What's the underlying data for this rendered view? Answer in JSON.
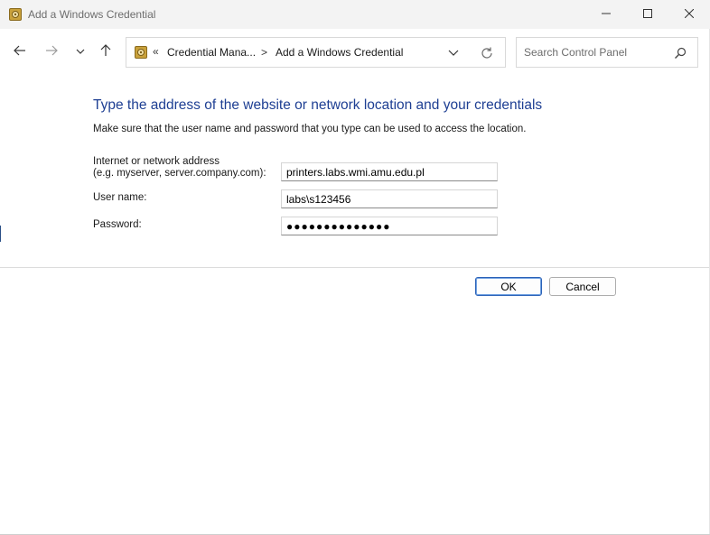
{
  "window": {
    "title": "Add a Windows Credential",
    "app_icon": "credential-manager-icon",
    "controls": [
      "minimize-icon",
      "maximize-icon",
      "close-icon"
    ]
  },
  "navigation": {
    "back_icon": "arrow-left-icon",
    "forward_icon": "arrow-right-icon",
    "recent_icon": "chevron-down-icon",
    "up_icon": "arrow-up-icon",
    "address": {
      "overflow_chevron": "«",
      "breadcrumbs": [
        "Credential Mana...",
        "Add a Windows Credential"
      ],
      "separator": ">"
    },
    "search": {
      "placeholder": "Search Control Panel"
    }
  },
  "form": {
    "heading": "Type the address of the website or network location and your credentials",
    "description": "Make sure that the user name and password that you type can be used to access the location.",
    "address_label_line1": "Internet or network address",
    "address_label_line2": "(e.g. myserver, server.company.com):",
    "address_value": "printers.labs.wmi.amu.edu.pl",
    "username_label": "User name:",
    "username_value": "labs\\s123456",
    "password_label": "Password:",
    "password_value": "●●●●●●●●●●●●●●"
  },
  "buttons": {
    "ok": "OK",
    "cancel": "Cancel"
  },
  "colors": {
    "heading": "#1e3f93",
    "ok_border": "#2b62b8",
    "titlebar": "#f3f3f3"
  }
}
